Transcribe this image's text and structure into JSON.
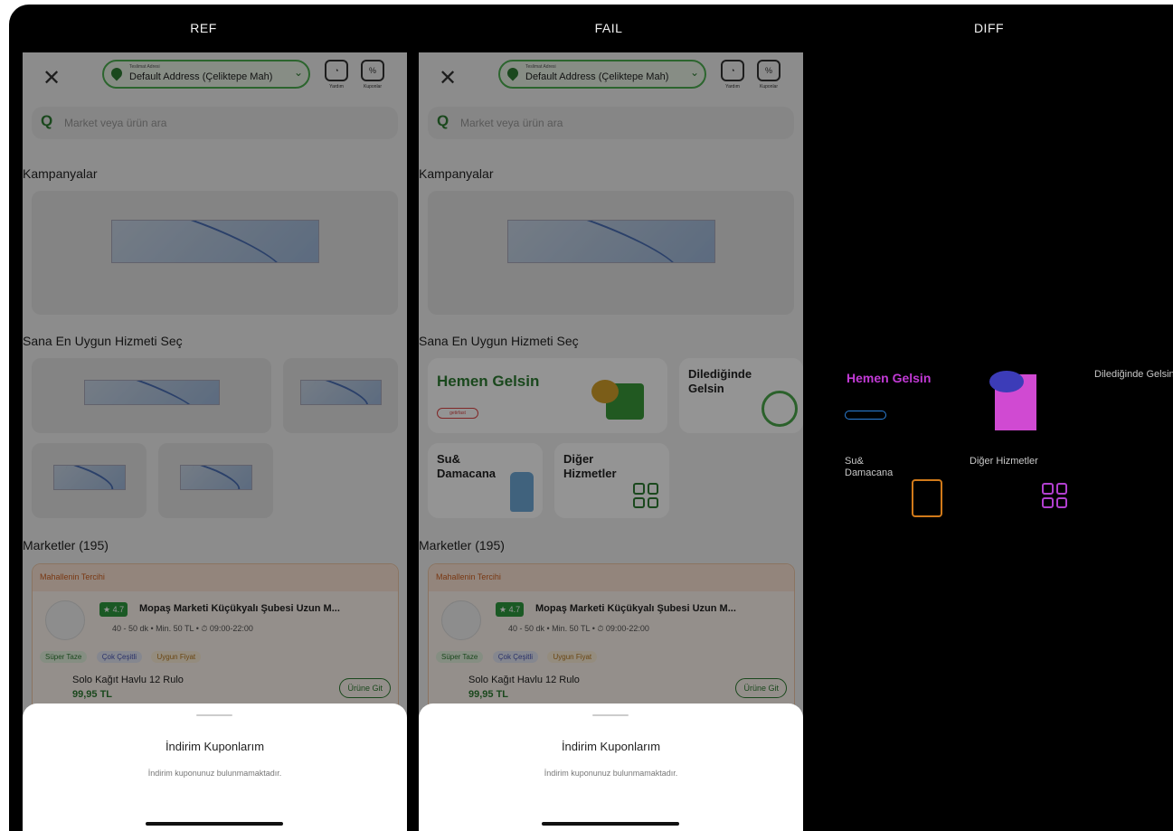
{
  "columns": [
    "REF",
    "FAIL",
    "DIFF"
  ],
  "screen": {
    "address_small": "Teslimat Adresi",
    "address": "Default Address (Çeliktepe Mah)",
    "help_label": "Yardım",
    "coupons_label": "Kuponlar",
    "search_placeholder": "Market veya ürün ara",
    "campaigns_title": "Kampanyalar",
    "services_title": "Sana En Uygun Hizmeti Seç",
    "services": {
      "hemen": "Hemen Gelsin",
      "hemen_badge": "getirfast",
      "diledigin": "Dilediğinde Gelsin",
      "su": "Su& Damacana",
      "diger": "Diğer Hizmetler"
    },
    "markets_title": "Marketler (195)",
    "market": {
      "header": "Mahallenin Tercihi",
      "rating": "★ 4.7",
      "name": "Mopaş Marketi Küçükyalı Şubesi Uzun M...",
      "info": "40 - 50 dk • Min. 50 TL • ⏱ 09:00-22:00",
      "tags": [
        "Süper Taze",
        "Çok Çeşitli",
        "Uygun Fiyat"
      ],
      "product": "Solo Kağıt Havlu 12 Rulo",
      "price": "99,95 TL",
      "go_button": "Ürüne Git"
    },
    "sheet_title": "İndirim Kuponlarım",
    "sheet_text": "İndirim kuponunuz bulunmamaktadır."
  },
  "diff": {
    "hemen": "Hemen Gelsin",
    "diledigin": "Dilediğinde Gelsin",
    "su": "Su& Damacana",
    "diger": "Diğer Hizmetler"
  }
}
